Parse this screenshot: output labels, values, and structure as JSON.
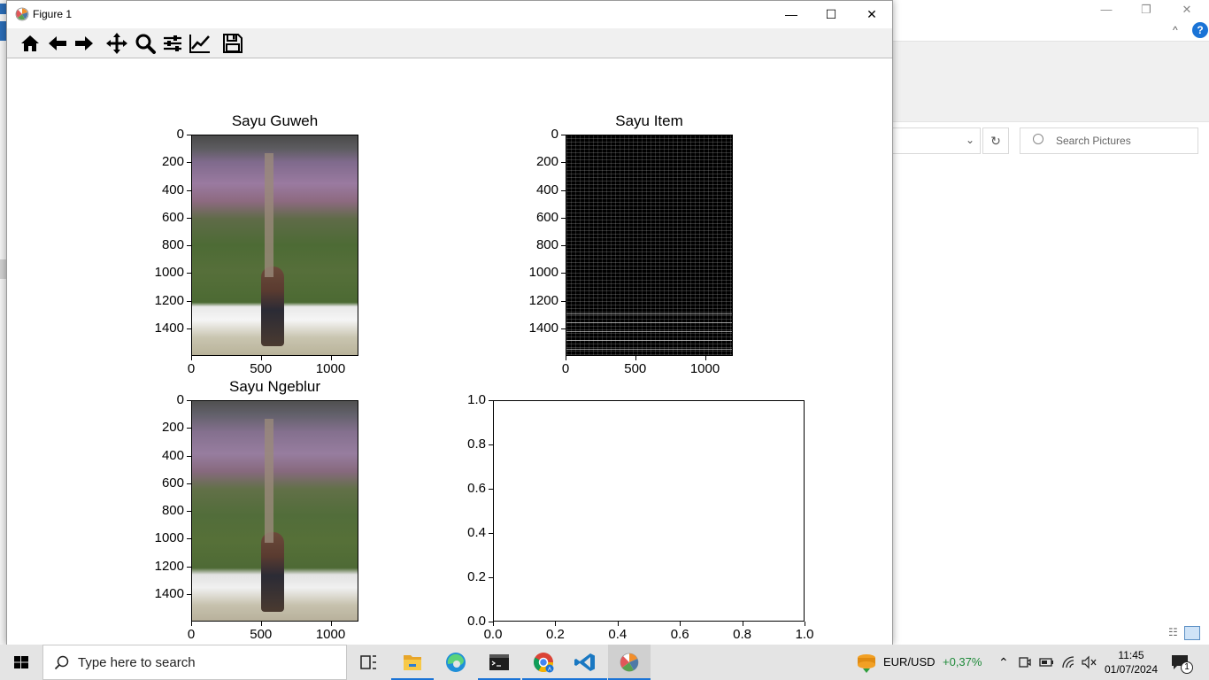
{
  "explorer": {
    "search_placeholder": "Search Pictures",
    "refresh_glyph": "↻",
    "dropdown_glyph": "⌄",
    "help_glyph": "?",
    "collapse_glyph": "^",
    "minimize_glyph": "—",
    "restore_glyph": "❐",
    "close_glyph": "✕"
  },
  "window": {
    "title": "Figure 1",
    "minimize_glyph": "—",
    "maximize_glyph": "☐",
    "close_glyph": "✕"
  },
  "toolbar": {
    "buttons": [
      "home-icon",
      "back-arrow-icon",
      "forward-arrow-icon",
      "pan-icon",
      "zoom-icon",
      "configure-subplots-icon",
      "edit-axes-icon",
      "save-icon"
    ]
  },
  "chart_data": [
    {
      "type": "image",
      "title": "Sayu Guweh",
      "yticks": [
        "0",
        "200",
        "400",
        "600",
        "800",
        "1000",
        "1200",
        "1400"
      ],
      "xticks": [
        "0",
        "500",
        "1000"
      ],
      "xlim": [
        0,
        1200
      ],
      "ylim": [
        1600,
        0
      ]
    },
    {
      "type": "image",
      "title": "Sayu Item",
      "yticks": [
        "0",
        "200",
        "400",
        "600",
        "800",
        "1000",
        "1200",
        "1400"
      ],
      "xticks": [
        "0",
        "500",
        "1000"
      ],
      "xlim": [
        0,
        1200
      ],
      "ylim": [
        1600,
        0
      ]
    },
    {
      "type": "image",
      "title": "Sayu Ngeblur",
      "yticks": [
        "0",
        "200",
        "400",
        "600",
        "800",
        "1000",
        "1200",
        "1400"
      ],
      "xticks": [
        "0",
        "500",
        "1000"
      ],
      "xlim": [
        0,
        1200
      ],
      "ylim": [
        1600,
        0
      ]
    },
    {
      "type": "line",
      "title": "",
      "series": [],
      "yticks": [
        "0.0",
        "0.2",
        "0.4",
        "0.6",
        "0.8",
        "1.0"
      ],
      "xticks": [
        "0.0",
        "0.2",
        "0.4",
        "0.6",
        "0.8",
        "1.0"
      ],
      "xlim": [
        0,
        1
      ],
      "ylim": [
        0,
        1
      ]
    }
  ],
  "taskbar": {
    "search_placeholder": "Type here to search",
    "apps": [
      "task-view-icon",
      "file-explorer-icon",
      "edge-icon",
      "terminal-icon",
      "chrome-icon",
      "vscode-icon",
      "matplotlib-icon"
    ],
    "ticker_label": "EUR/USD",
    "ticker_change": "+0,37%",
    "time": "11:45",
    "date": "01/07/2024",
    "notification_count": "1"
  }
}
